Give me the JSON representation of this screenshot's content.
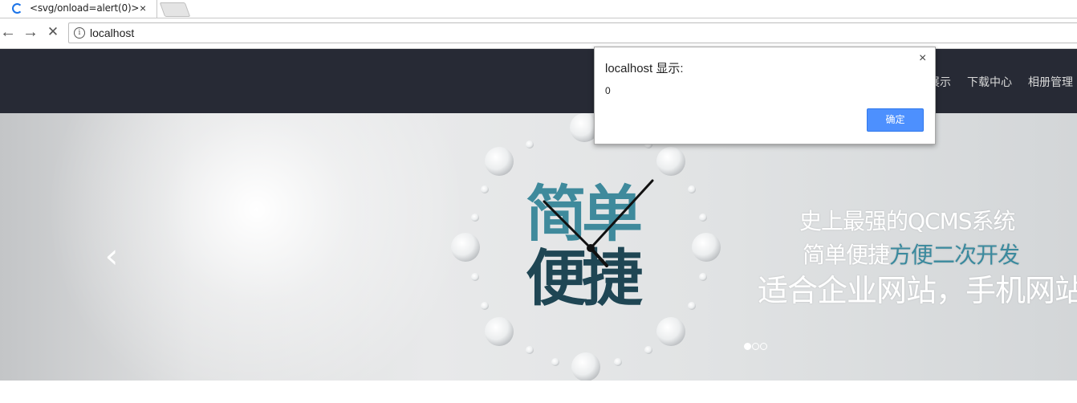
{
  "browser": {
    "tab": {
      "title": "<svg/onload=alert(0)>",
      "close_glyph": "×"
    },
    "toolbar": {
      "back": "←",
      "forward": "→",
      "stop": "✕",
      "url": "localhost",
      "info_glyph": "i"
    }
  },
  "site": {
    "nav": {
      "item_partial": "展示",
      "download": "下载中心",
      "album": "相册管理"
    }
  },
  "banner": {
    "big_text_line1": "简单",
    "big_text_line2": "便捷",
    "slogan_line1": "史上最强的QCMS系统",
    "slogan_line2_plain": "简单便捷",
    "slogan_line2_highlight": "方便二次开发",
    "slogan_line3": "适合企业网站，手机网站",
    "prev_arrow": "‹",
    "slides_total": 3,
    "slide_active": 1
  },
  "alert": {
    "title": "localhost 显示:",
    "message": "0",
    "ok_label": "确定",
    "close_glyph": "×"
  },
  "colors": {
    "header_bg": "#272a35",
    "highlight": "#3b8a9e",
    "ok_button": "#4d90fe"
  }
}
